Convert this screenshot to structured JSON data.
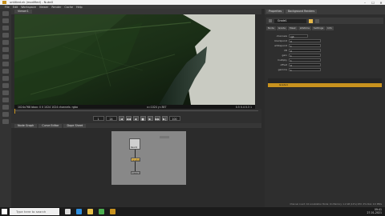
{
  "app": {
    "title": "untitled.nk (modified) - NukeX"
  },
  "window_controls": {
    "minimize": "–",
    "maximize": "☐",
    "close": "✕"
  },
  "menu": [
    "File",
    "Edit",
    "Workspace",
    "Viewer",
    "Render",
    "Cache",
    "Help"
  ],
  "viewer": {
    "tab": "Viewer1",
    "info_left": "1024x768  bbox: 0 0 1024 1024  channels: rgba",
    "info_mid": "x=1024 y=387",
    "info_right": "0.5 0.4 0.3 1"
  },
  "playback": {
    "buttons": [
      "|◀",
      "◀◀",
      "◀",
      "■",
      "▶",
      "▶▶",
      "▶|"
    ],
    "frame": "1",
    "fps": "24",
    "end": "100"
  },
  "node_graph": {
    "tabs": [
      "Node Graph",
      "Curve Editor",
      "Dope Sheet"
    ],
    "nodes": [
      {
        "name": "Read1"
      },
      {
        "name": "Grade1"
      },
      {
        "name": "Viewer1"
      }
    ]
  },
  "properties": {
    "tabs": [
      "Properties",
      "Background Renders"
    ],
    "node_name": "Grade1",
    "knob_tabs": [
      "Node",
      "Grade",
      "Mask",
      "Lifetime",
      "Settings",
      "Info"
    ],
    "knobs": [
      {
        "label": "channels",
        "value": "rgb"
      },
      {
        "label": "blackpoint",
        "value": "0"
      },
      {
        "label": "whitepoint",
        "value": "1"
      },
      {
        "label": "lift",
        "value": "0"
      },
      {
        "label": "gain",
        "value": "1"
      },
      {
        "label": "multiply",
        "value": "1"
      },
      {
        "label": "offset",
        "value": "0"
      },
      {
        "label": "gamma",
        "value": "1"
      }
    ],
    "layer_row": "Grade1"
  },
  "taskbar": {
    "search_placeholder": "Type here to search",
    "time": "09:41",
    "date": "27-01-2021"
  },
  "status": "Channel count: 16  Localization Mode: On  Memory: 1.2 GB (12%)  CPU: 4%  Disk: 0.0 MB/s"
}
